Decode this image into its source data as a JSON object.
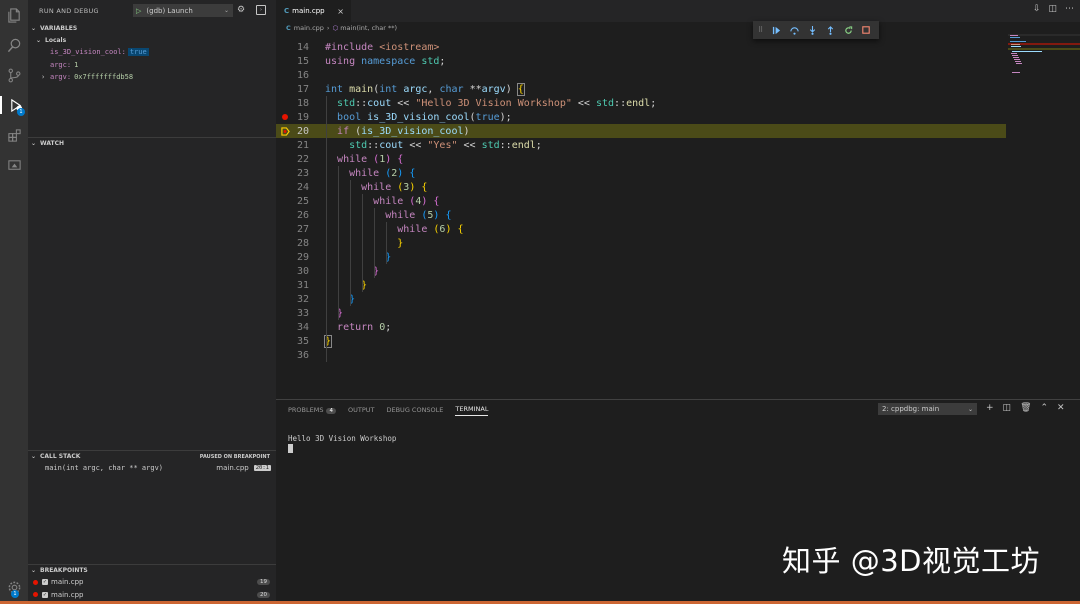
{
  "sidebar": {
    "title": "RUN AND DEBUG",
    "launch_config": "(gdb) Launch",
    "sections": {
      "variables": "VARIABLES",
      "locals": "Locals",
      "watch": "WATCH",
      "call_stack": "CALL STACK",
      "call_stack_status": "PAUSED ON BREAKPOINT",
      "breakpoints": "BREAKPOINTS"
    },
    "variables": [
      {
        "name": "is_3D_vision_cool:",
        "value": "true"
      },
      {
        "name": "argc:",
        "value": "1"
      },
      {
        "name": "argv:",
        "value": "0x7fffffffdb58"
      }
    ],
    "call_stack": [
      {
        "frame": "main(int argc, char ** argv)",
        "file": "main.cpp",
        "line": "20:1"
      }
    ],
    "breakpoints": [
      {
        "file": "main.cpp",
        "line": "19"
      },
      {
        "file": "main.cpp",
        "line": "20"
      }
    ]
  },
  "activity_badges": {
    "debug": "1",
    "settings": "1"
  },
  "editor": {
    "tab": "main.cpp",
    "tab_close": "×",
    "breadcrumb_file": "main.cpp",
    "breadcrumb_symbol": "main(int, char **)",
    "lines": [
      {
        "n": "14"
      },
      {
        "n": "15"
      },
      {
        "n": "16"
      },
      {
        "n": "17"
      },
      {
        "n": "18"
      },
      {
        "n": "19"
      },
      {
        "n": "20"
      },
      {
        "n": "21"
      },
      {
        "n": "22"
      },
      {
        "n": "23"
      },
      {
        "n": "24"
      },
      {
        "n": "25"
      },
      {
        "n": "26"
      },
      {
        "n": "27"
      },
      {
        "n": "28"
      },
      {
        "n": "29"
      },
      {
        "n": "30"
      },
      {
        "n": "31"
      },
      {
        "n": "32"
      },
      {
        "n": "33"
      },
      {
        "n": "34"
      },
      {
        "n": "35"
      },
      {
        "n": "36"
      }
    ],
    "code": {
      "l14_a": "#include ",
      "l14_b": "<iostream>",
      "l15_a": "using ",
      "l15_b": "namespace ",
      "l15_c": "std",
      "l15_d": ";",
      "l17_a": "int ",
      "l17_b": "main",
      "l17_c": "(",
      "l17_d": "int ",
      "l17_e": "argc",
      "l17_f": ", ",
      "l17_g": "char ",
      "l17_h": "**",
      "l17_i": "argv",
      "l17_j": ") ",
      "l17_k": "{",
      "l18_a": "std",
      "l18_b": "::",
      "l18_c": "cout",
      "l18_d": " << ",
      "l18_e": "\"Hello 3D Vision Workshop\"",
      "l18_f": " << ",
      "l18_g": "std",
      "l18_h": "::",
      "l18_i": "endl",
      "l18_j": ";",
      "l19_a": "bool ",
      "l19_b": "is_3D_vision_cool",
      "l19_c": "(",
      "l19_d": "true",
      "l19_e": ");",
      "l20_a": "if ",
      "l20_b": "(",
      "l20_c": "is_3D_vision_cool",
      "l20_d": ")",
      "l21_a": "std",
      "l21_b": "::",
      "l21_c": "cout",
      "l21_d": " << ",
      "l21_e": "\"Yes\"",
      "l21_f": " << ",
      "l21_g": "std",
      "l21_h": "::",
      "l21_i": "endl",
      "l21_j": ";",
      "while": "while ",
      "n1": "1",
      "n2": "2",
      "n3": "3",
      "n4": "4",
      "n5": "5",
      "n6": "6",
      "lp": "(",
      "rp": ") ",
      "lb": "{",
      "rb": "}",
      "l34_a": "return ",
      "l34_b": "0",
      "l34_c": ";"
    }
  },
  "panel": {
    "tabs": [
      "PROBLEMS",
      "OUTPUT",
      "DEBUG CONSOLE",
      "TERMINAL"
    ],
    "problems_count": "4",
    "terminal_select": "2: cppdbg: main",
    "terminal_output": "Hello 3D Vision Workshop"
  },
  "watermark": "知乎 @3D视觉工坊",
  "colors": {
    "accent": "#007acc",
    "current_line": "#4b4b18",
    "breakpoint": "#e51400",
    "statusbar": "#cc6633"
  }
}
